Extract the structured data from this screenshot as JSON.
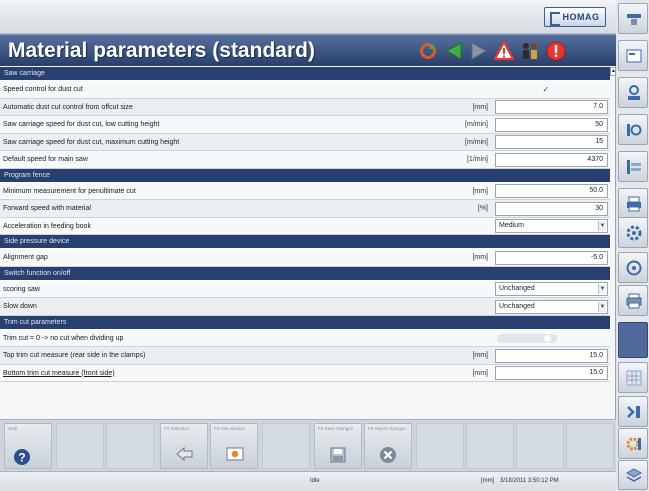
{
  "header": {
    "logo_text": "HOMAG",
    "title": "Material parameters (standard)"
  },
  "sections": [
    {
      "title": "Saw carriage",
      "rows": [
        {
          "label": "Speed control for dust cut",
          "unit": "",
          "type": "check",
          "value": "✓"
        },
        {
          "label": "Automatic dust cut control from offcut size",
          "unit": "[mm]",
          "type": "number",
          "value": "7.0"
        },
        {
          "label": "Saw carriage speed for dust cut, low cutting height",
          "unit": "[m/min]",
          "type": "number",
          "value": "50"
        },
        {
          "label": "Saw carriage speed for dust cut, maximum cutting height",
          "unit": "[m/min]",
          "type": "number",
          "value": "15"
        },
        {
          "label": "Default speed for main saw",
          "unit": "[1/min]",
          "type": "number",
          "value": "4370"
        }
      ]
    },
    {
      "title": "Program fence",
      "rows": [
        {
          "label": "Minimum measurement for penultimate cut",
          "unit": "[mm]",
          "type": "number",
          "value": "50.0"
        },
        {
          "label": "Forward speed with material",
          "unit": "[%]",
          "type": "number",
          "value": "30"
        },
        {
          "label": "Acceleration in feeding book",
          "unit": "",
          "type": "select",
          "value": "Medium"
        }
      ]
    },
    {
      "title": "Side pressure device",
      "rows": [
        {
          "label": "Alignment gap",
          "unit": "[mm]",
          "type": "number",
          "value": "-5.0"
        }
      ]
    },
    {
      "title": "Switch function on/off",
      "rows": [
        {
          "label": "scoring saw",
          "unit": "",
          "type": "select",
          "value": "Unchanged"
        },
        {
          "label": "Slow down",
          "unit": "",
          "type": "select",
          "value": "Unchanged"
        }
      ]
    },
    {
      "title": "Trim cut parameters",
      "rows": [
        {
          "label": "Trim cut = 0 -> no cut when dividing up",
          "unit": "",
          "type": "toggle",
          "value": ""
        },
        {
          "label": "Top trim cut measure (rear side in the clamps)",
          "unit": "[mm]",
          "type": "number",
          "value": "15.0"
        },
        {
          "label": "Bottom trim cut measure (front side)",
          "unit": "[mm]",
          "type": "number",
          "value": "15.0"
        }
      ]
    }
  ],
  "toolbar": {
    "help_label": "Help",
    "buttons": [
      {
        "label": "F2 Selection",
        "icon": "arrow-back-icon"
      },
      {
        "label": "F3 Hint window",
        "icon": "info-icon"
      },
      {
        "label": "F5 Save changes",
        "icon": "save-icon"
      },
      {
        "label": "F6 Reject changes",
        "icon": "reject-icon"
      }
    ]
  },
  "status": {
    "mode": "Idle",
    "unit": "[mm]",
    "datetime": "3/18/2011 3:50:12 PM"
  },
  "colors": {
    "accent": "#27406f",
    "title_bar": "#3b5584",
    "warning": "#e8382d"
  }
}
